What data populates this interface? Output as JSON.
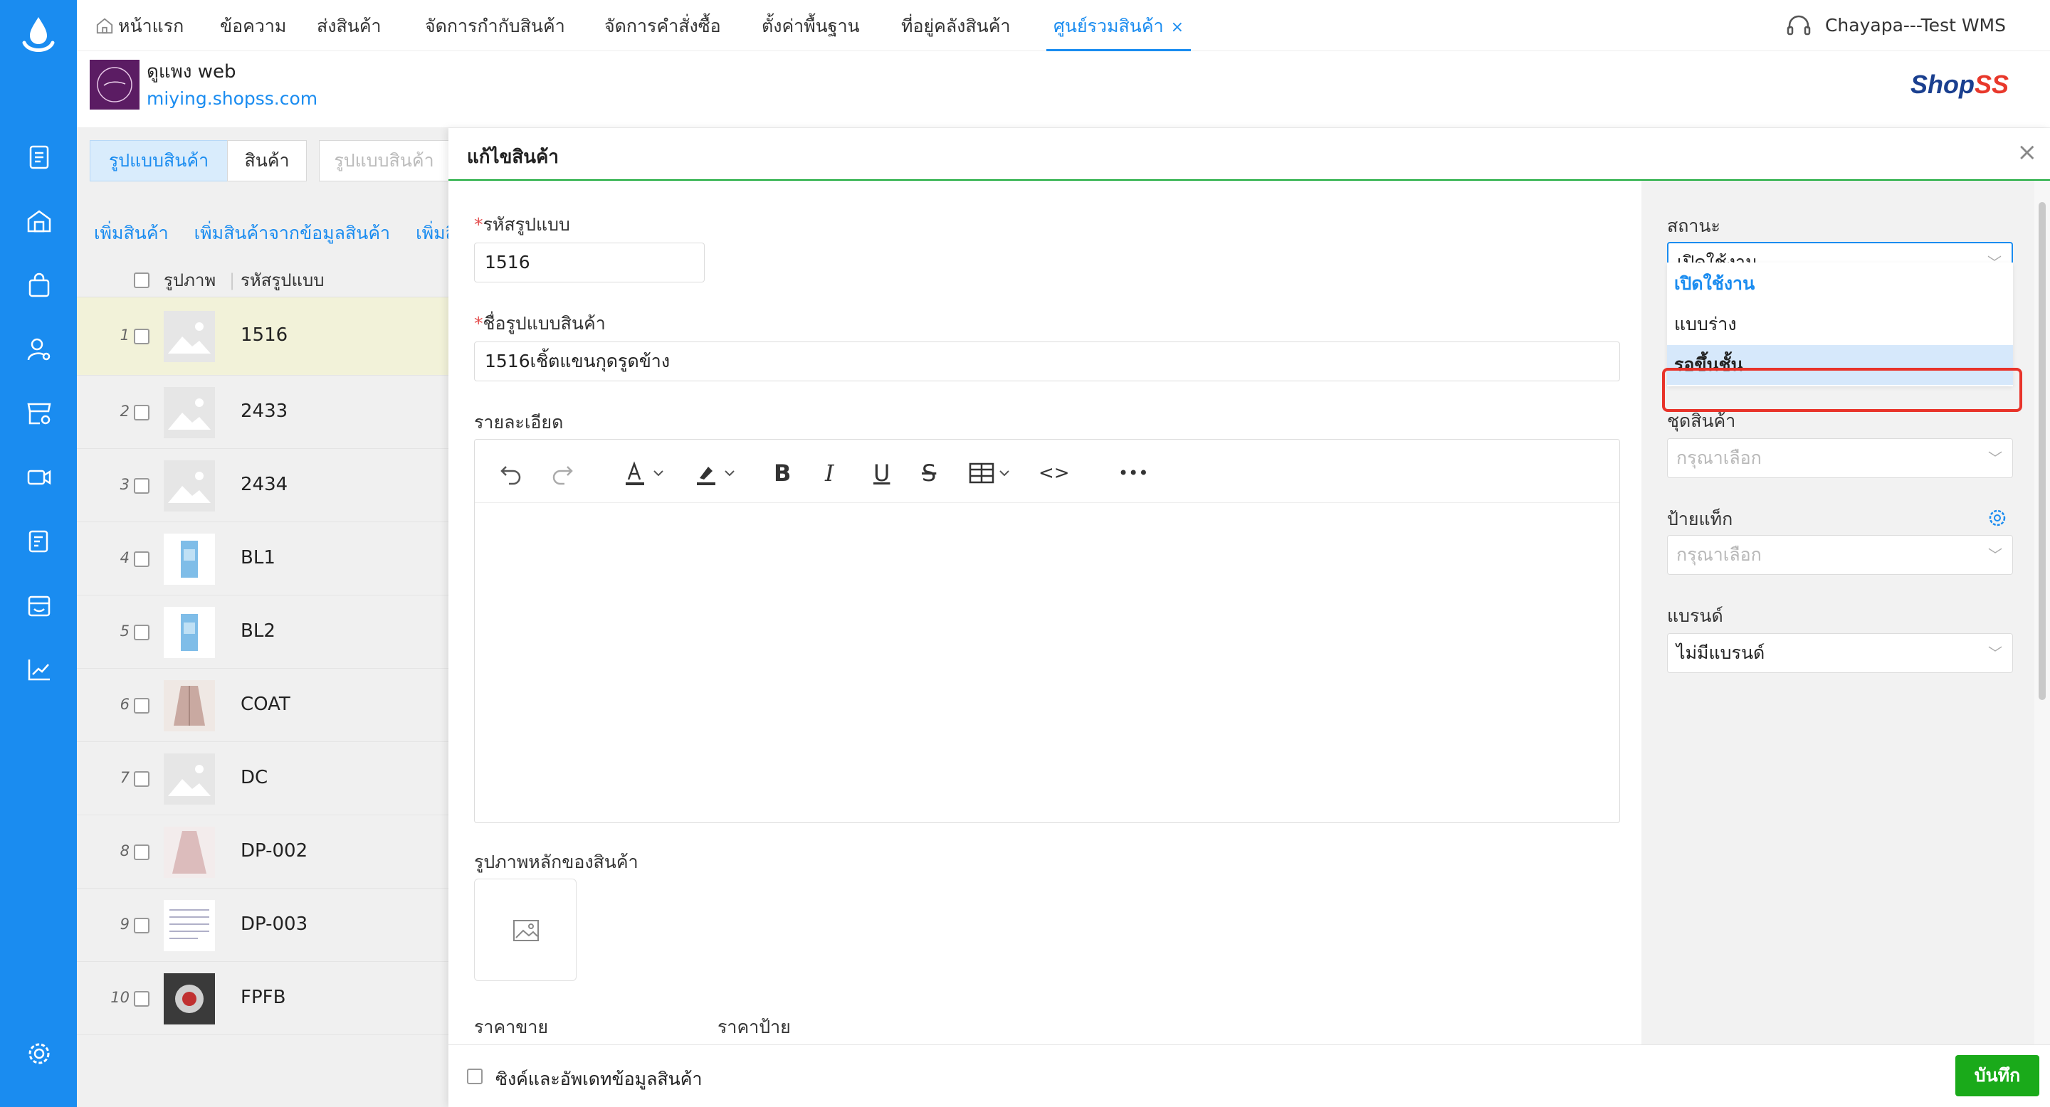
{
  "nav": {
    "tabs": [
      "หน้าแรก",
      "ข้อความ",
      "ส่งสินค้า",
      "จัดการกำกับสินค้า",
      "จัดการคำสั่งซื้อ",
      "ตั้งค่าพื้นฐาน",
      "ที่อยู่คลังสินค้า",
      "ศูนย์รวมสินค้า"
    ],
    "close_glyph": "×",
    "user": "Chayapa---Test WMS"
  },
  "shop": {
    "name": "ดูแพง web",
    "url": "miying.shopss.com",
    "brand_a": "Shop",
    "brand_b": "SS"
  },
  "left": {
    "segments": [
      "รูปแบบสินค้า",
      "สินค้า",
      "รูปแบบสินค้า"
    ],
    "actions": [
      "เพิ่มสินค้า",
      "เพิ่มสินค้าจากข้อมูลสินค้า",
      "เพิ่มสิ"
    ],
    "headers": {
      "image": "รูปภาพ",
      "code": "รหัสรูปแบบ"
    },
    "rows": [
      {
        "num": "1",
        "code": "1516"
      },
      {
        "num": "2",
        "code": "2433"
      },
      {
        "num": "3",
        "code": "2434"
      },
      {
        "num": "4",
        "code": "BL1"
      },
      {
        "num": "5",
        "code": "BL2"
      },
      {
        "num": "6",
        "code": "COAT"
      },
      {
        "num": "7",
        "code": "DC"
      },
      {
        "num": "8",
        "code": "DP-002"
      },
      {
        "num": "9",
        "code": "DP-003"
      },
      {
        "num": "10",
        "code": "FPFB"
      }
    ]
  },
  "panel": {
    "title": "แก้ไขสินค้า",
    "close": "×",
    "required_mark": "*",
    "code_label": "รหัสรูปแบบ",
    "code_value": "1516",
    "name_label": "ชื่อรูปแบบสินค้า",
    "name_value": "1516เชิ้ตแขนกุดรูดข้าง",
    "detail_label": "รายละเอียด",
    "main_image_label": "รูปภาพหลักของสินค้า",
    "price_label": "ราคาขาย",
    "tag_price_label": "ราคาป้าย",
    "toolbar": {
      "bold": "B",
      "italic": "I",
      "underline": "U",
      "strike": "S",
      "code": "<>",
      "more": "•••"
    },
    "status_label": "สถานะ",
    "status_value": "เปิดใช้งาน",
    "status_options": [
      "เปิดใช้งาน",
      "แบบร่าง",
      "รอขึ้นชั้น"
    ],
    "set_label": "ชุดสินค้า",
    "set_placeholder": "กรุณาเลือก",
    "tag_label": "ป้ายแท็ก",
    "tag_placeholder": "กรุณาเลือก",
    "brand_label": "แบรนด์",
    "brand_value": "ไม่มีแบรนด์",
    "sync_label": "ซิงค์และอัพเดทข้อมูลสินค้า",
    "save_label": "บันทึก"
  },
  "colors": {
    "primary": "#1a8cf0",
    "save": "#1aaa1a",
    "highlight": "#e8332a"
  }
}
